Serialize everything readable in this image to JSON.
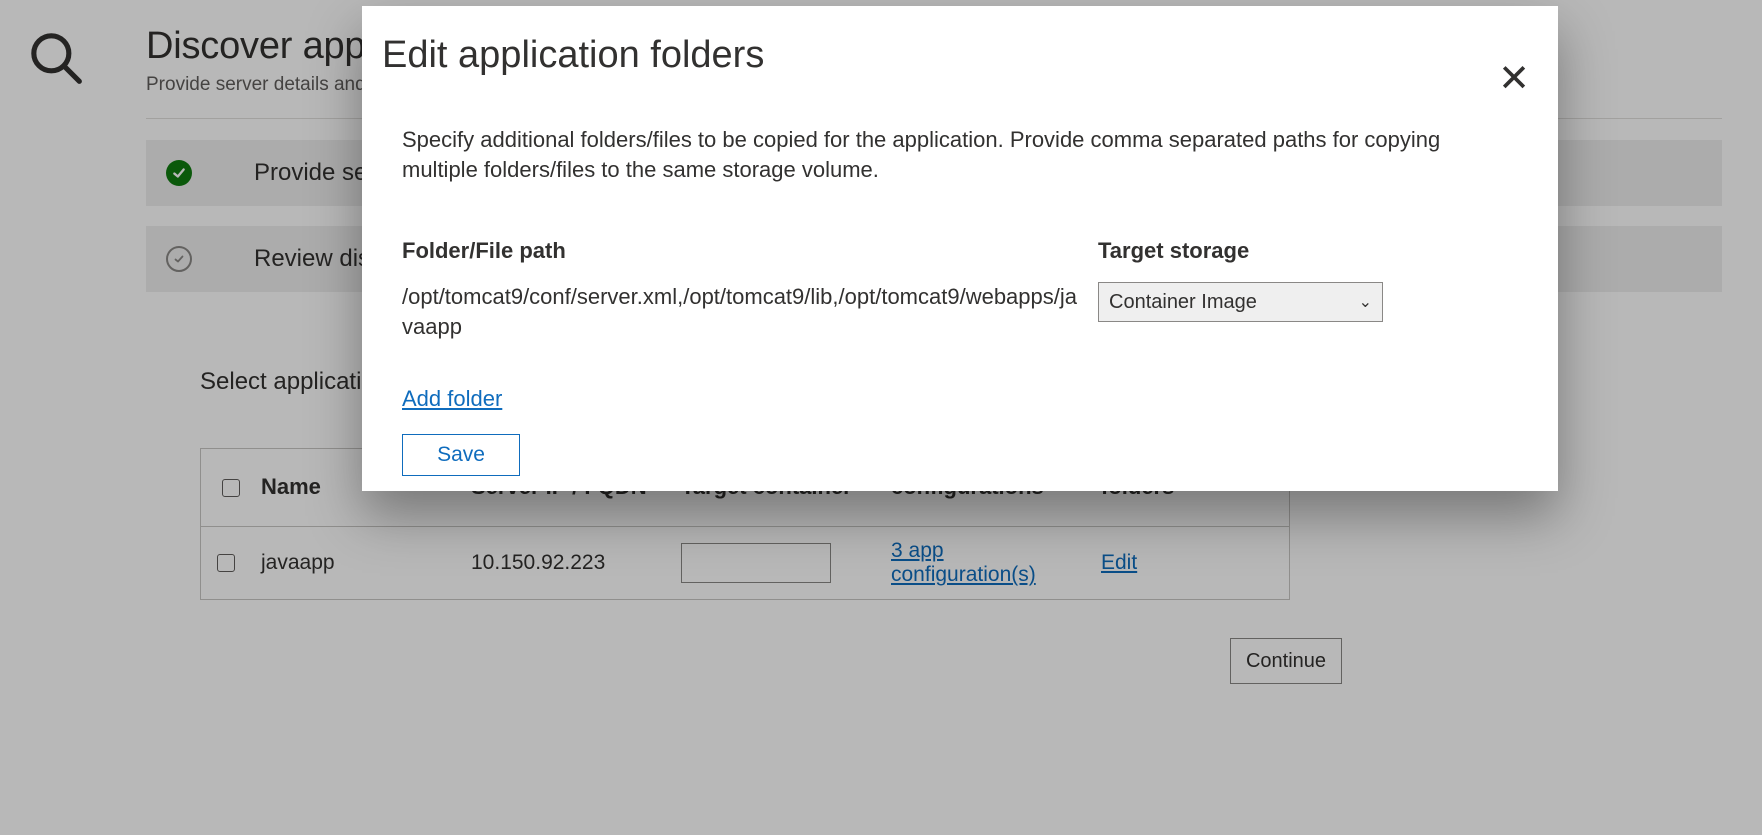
{
  "page": {
    "title": "Discover applica",
    "subtitle": "Provide server details and run",
    "steps": {
      "step1_label": "Provide se",
      "step2_label": "Review dis"
    },
    "section_label": "Select applications",
    "continue_label": "Continue"
  },
  "table": {
    "headers": {
      "name": "Name",
      "server": "Server IP / FQDN",
      "target_container": "Target container",
      "configurations": "configurations",
      "folders": "folders"
    },
    "rows": [
      {
        "name": "javaapp",
        "server": "10.150.92.223",
        "target_container": "",
        "config_link": "3 app configuration(s)",
        "folders_link": "Edit"
      }
    ]
  },
  "modal": {
    "title": "Edit application folders",
    "description": "Specify additional folders/files to be copied for the application. Provide comma separated paths for copying multiple folders/files to the same storage volume.",
    "path_label": "Folder/File path",
    "storage_label": "Target storage",
    "path_value": "/opt/tomcat9/conf/server.xml,/opt/tomcat9/lib,/opt/tomcat9/webapps/javaapp",
    "storage_selected": "Container Image",
    "add_folder_label": "Add folder",
    "save_label": "Save"
  },
  "icons": {
    "close_glyph": "✕",
    "chevron_down": "⌄"
  }
}
